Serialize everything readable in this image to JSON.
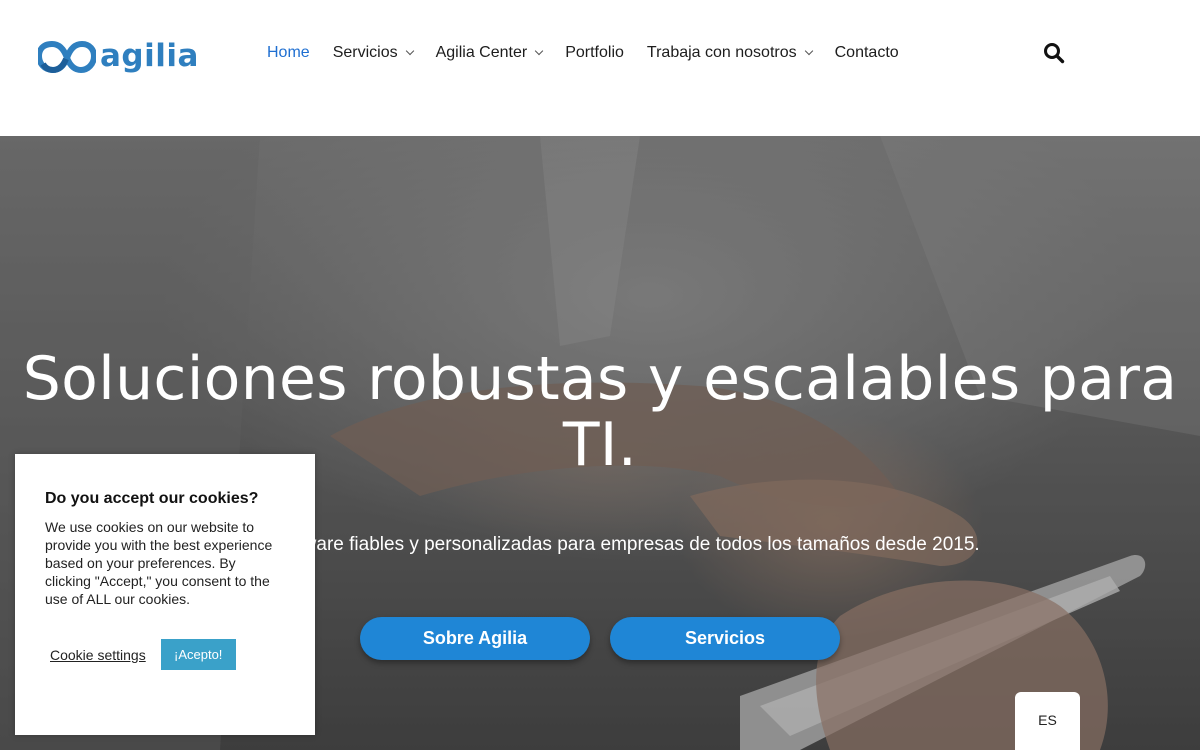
{
  "brand": {
    "name": "agilia",
    "color": "#2f7fbf"
  },
  "nav": {
    "items": [
      {
        "label": "Home",
        "active": true,
        "dropdown": false
      },
      {
        "label": "Servicios",
        "active": false,
        "dropdown": true
      },
      {
        "label": "Agilia Center",
        "active": false,
        "dropdown": true
      },
      {
        "label": "Portfolio",
        "active": false,
        "dropdown": false
      },
      {
        "label": "Trabaja con nosotros",
        "active": false,
        "dropdown": true
      },
      {
        "label": "Contacto",
        "active": false,
        "dropdown": false
      }
    ],
    "search_icon": "search-icon"
  },
  "hero": {
    "title": "Soluciones robustas y escalables para TI.",
    "subtitle": "es de software fiables y personalizadas para empresas de todos los tamaños desde 2015.",
    "buttons": {
      "about": "Sobre Agilia",
      "services": "Servicios"
    },
    "button_color": "#1f86d6"
  },
  "cookie": {
    "title": "Do you accept our cookies?",
    "text": "We use cookies on our website to provide you with the best experience based on your preferences. By clicking \"Accept,\" you consent to the use of ALL our cookies.",
    "settings_label": "Cookie settings",
    "accept_label": "¡Acepto!",
    "accept_color": "#3aa1c9"
  },
  "language": {
    "current": "ES"
  }
}
